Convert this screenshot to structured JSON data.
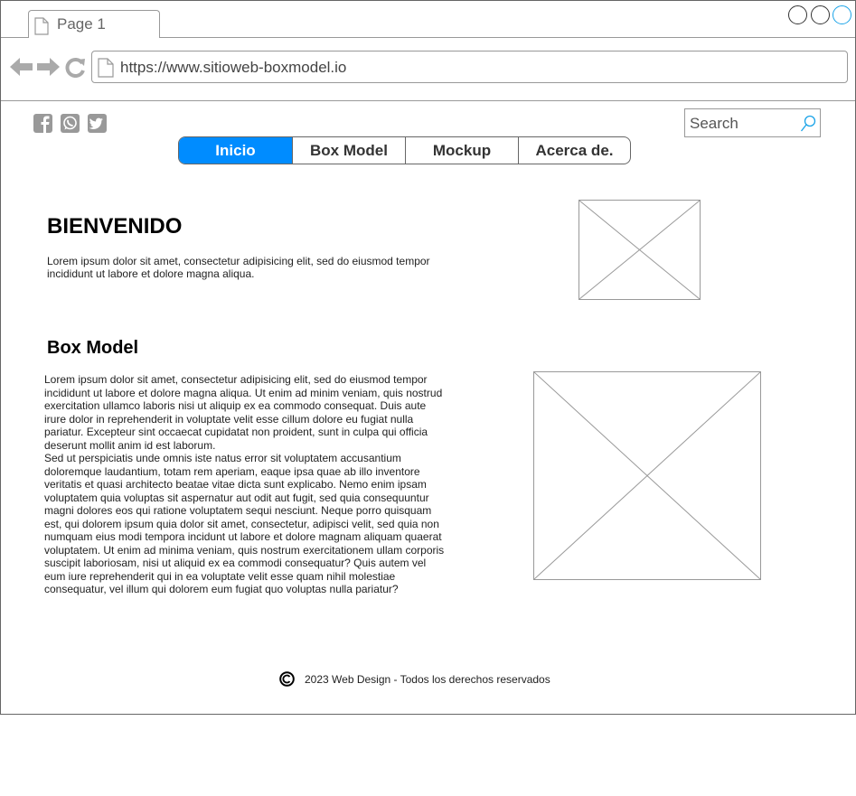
{
  "browser": {
    "tab_label": "Page 1",
    "url": "https://www.sitioweb-boxmodel.io"
  },
  "header": {
    "social_icons": [
      "facebook-icon",
      "whatsapp-icon",
      "twitter-icon"
    ],
    "search_placeholder": "Search"
  },
  "nav": {
    "items": [
      "Inicio",
      "Box Model",
      "Mockup",
      "Acerca de."
    ],
    "active_color": "#008cff"
  },
  "welcome": {
    "title": "BIENVENIDO",
    "text": "Lorem ipsum dolor sit amet, consectetur adipisicing elit, sed do eiusmod tempor incididunt ut labore et dolore magna aliqua."
  },
  "boxmodel": {
    "title": "Box Model",
    "text": "Lorem ipsum dolor sit amet, consectetur adipisicing elit, sed do eiusmod tempor incididunt ut labore et dolore magna aliqua. Ut enim ad minim veniam, quis nostrud exercitation ullamco laboris nisi ut aliquip ex ea commodo consequat. Duis aute irure dolor in reprehenderit in voluptate velit esse cillum dolore eu fugiat nulla pariatur. Excepteur sint occaecat cupidatat non proident, sunt in culpa qui officia deserunt mollit anim id est laborum.\nSed ut perspiciatis unde omnis iste natus error sit voluptatem accusantium doloremque laudantium, totam rem aperiam, eaque ipsa quae ab illo inventore veritatis et quasi architecto beatae vitae dicta sunt explicabo. Nemo enim ipsam voluptatem quia voluptas sit aspernatur aut odit aut fugit, sed quia consequuntur magni dolores eos qui ratione voluptatem sequi nesciunt. Neque porro quisquam est, qui dolorem ipsum quia dolor sit amet, consectetur, adipisci velit, sed quia non numquam eius modi tempora incidunt ut labore et dolore magnam aliquam quaerat voluptatem. Ut enim ad minima veniam, quis nostrum exercitationem ullam corporis suscipit laboriosam, nisi ut aliquid ex ea commodi consequatur? Quis autem vel eum iure reprehenderit qui in ea voluptate velit esse quam nihil molestiae consequatur, vel illum qui dolorem eum fugiat quo voluptas nulla pariatur?"
  },
  "footer": {
    "text": "2023 Web Design - Todos los derechos reservados"
  }
}
